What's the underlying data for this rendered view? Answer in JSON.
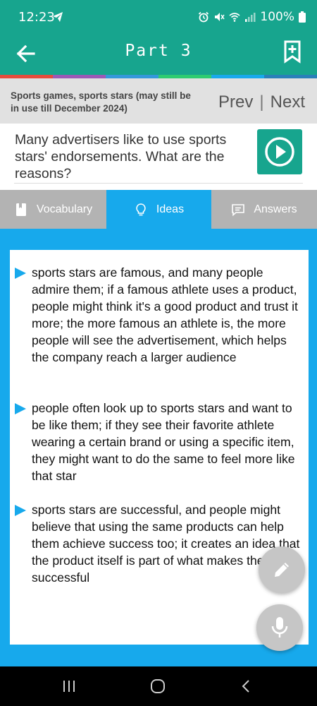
{
  "status_bar": {
    "time": "12:23",
    "battery": "100%"
  },
  "app_bar": {
    "title": "Part 3"
  },
  "question_header": {
    "topic": "Sports games, sports stars (may still be in use till December 2024)",
    "prev_label": "Prev",
    "separator": "|",
    "next_label": "Next"
  },
  "question": {
    "text": "Many advertisers like to use sports stars' endorsements. What are the reasons?"
  },
  "tabs": [
    {
      "label": "Vocabulary",
      "icon": "book-icon",
      "active": false
    },
    {
      "label": "Ideas",
      "icon": "lightbulb-icon",
      "active": true
    },
    {
      "label": "Answers",
      "icon": "chat-icon",
      "active": false
    }
  ],
  "ideas": [
    "sports stars are famous, and many people admire them; if a famous athlete uses a product, people might think it's a good product and trust it more; the more famous an athlete is, the more people will see the advertisement, which helps the company reach a larger audience",
    "people often look up to sports stars and want to be like them; if they see their favorite athlete wearing a certain brand or using a specific item, they might want to do the same to feel more like that star",
    "sports stars are successful, and people might believe that using the same products can help them achieve success too; it creates an idea that the product itself is part of what makes the star successful"
  ],
  "colors": {
    "primary": "#17a58e",
    "accent": "#17a9ec",
    "tab_inactive": "#b3b3b3",
    "rainbow": [
      "#e74c3c",
      "#9b59b6",
      "#3498db",
      "#2ecc71",
      "#17a9ec",
      "#2980b9"
    ]
  },
  "fabs": [
    {
      "icon": "pencil-icon"
    },
    {
      "icon": "microphone-icon"
    }
  ],
  "system_nav": [
    {
      "icon": "recents-icon"
    },
    {
      "icon": "home-icon"
    },
    {
      "icon": "back-icon"
    }
  ]
}
